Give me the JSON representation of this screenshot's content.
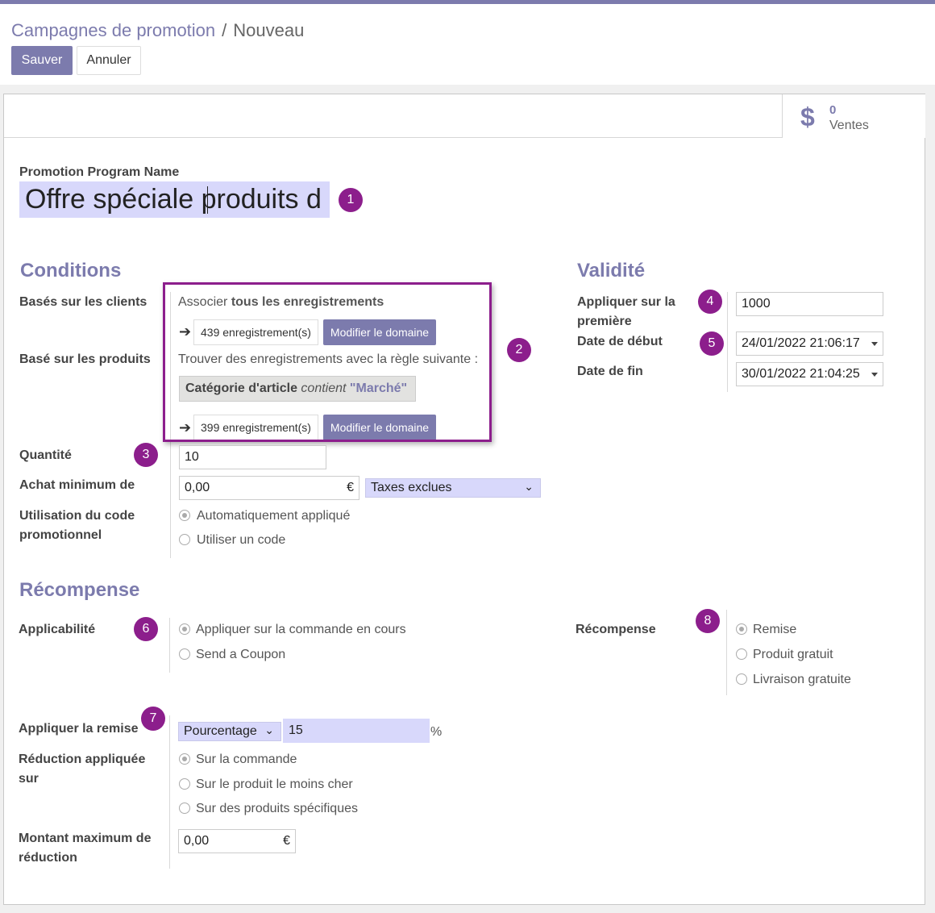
{
  "breadcrumb": {
    "parent": "Campagnes de promotion",
    "separator": "/",
    "current": "Nouveau"
  },
  "buttons": {
    "save": "Sauver",
    "discard": "Annuler"
  },
  "stat": {
    "icon": "dollar-icon",
    "value": "0",
    "label": "Ventes"
  },
  "name": {
    "label": "Promotion Program Name",
    "value": "Offre spéciale produits d"
  },
  "badges": [
    "1",
    "2",
    "3",
    "4",
    "5",
    "6",
    "7",
    "8"
  ],
  "conditions": {
    "title": "Conditions",
    "customers_label": "Basés sur les clients",
    "match_prefix": "Associer",
    "match_strong": "tous les enregistrements",
    "customers_records": "439 enregistrement(s)",
    "edit_domain": "Modifier le domaine",
    "products_label": "Basé sur les produits",
    "rule_text": "Trouver des enregistrements avec la règle suivante :",
    "rule_field": "Catégorie d'article",
    "rule_op": "contient",
    "rule_value": "\"Marché\"",
    "products_records": "399 enregistrement(s)",
    "quantity_label": "Quantité",
    "quantity_value": "10",
    "min_purchase_label": "Achat minimum de",
    "min_purchase_value": "0,00",
    "currency": "€",
    "tax_option": "Taxes exclues",
    "code_label_1": "Utilisation du code",
    "code_label_2": "promotionnel",
    "code_auto": "Automatiquement appliqué",
    "code_use": "Utiliser un code"
  },
  "validity": {
    "title": "Validité",
    "apply_first_label_1": "Appliquer sur la",
    "apply_first_label_2": "première",
    "apply_first_value": "1000",
    "start_label": "Date de début",
    "start_value": "24/01/2022 21:06:17",
    "end_label": "Date de fin",
    "end_value": "30/01/2022 21:04:25"
  },
  "reward": {
    "title": "Récompense",
    "applicability_label": "Applicabilité",
    "app_current": "Appliquer sur la commande en cours",
    "app_coupon": "Send a Coupon",
    "reward_label": "Récompense",
    "reward_discount": "Remise",
    "reward_free_product": "Produit gratuit",
    "reward_free_shipping": "Livraison gratuite",
    "apply_discount_label": "Appliquer la remise",
    "discount_type": "Pourcentage",
    "discount_value": "15",
    "percent": "%",
    "applied_on_label_1": "Réduction appliquée",
    "applied_on_label_2": "sur",
    "on_order": "Sur la commande",
    "on_cheapest": "Sur le produit le moins cher",
    "on_specific": "Sur des produits spécifiques",
    "max_amount_label_1": "Montant maximum de",
    "max_amount_label_2": "réduction",
    "max_amount_value": "0,00",
    "currency": "€"
  }
}
